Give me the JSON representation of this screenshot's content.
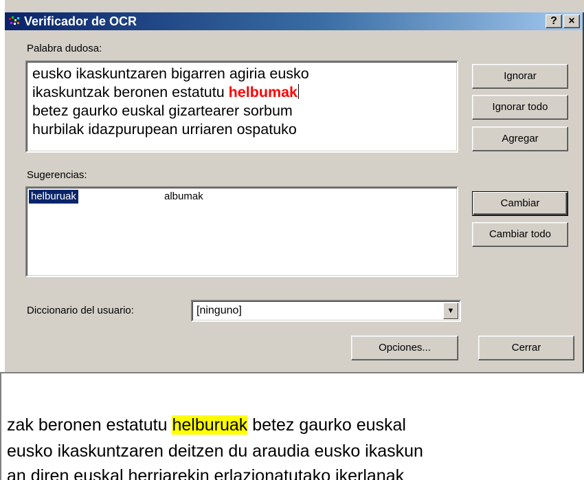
{
  "window": {
    "title": "Verificador de OCR",
    "help_button": "?",
    "close_button": "×"
  },
  "doubtful_word": {
    "label": "Palabra dudosa:",
    "text_before": "eusko ikaskuntzaren bigarren agiria eusko ikaskuntzak beronen estatutu ",
    "highlighted_word": "helbumak",
    "text_after": " betez gaurko euskal gizartearer sorbum hurbilak idazpurupean urriaren ospatuko",
    "highlight_color": "#ff0000"
  },
  "buttons": {
    "ignore": "Ignorar",
    "ignore_all": "Ignorar todo",
    "add": "Agregar",
    "change": "Cambiar",
    "change_all": "Cambiar todo",
    "options": "Opciones...",
    "close": "Cerrar"
  },
  "suggestions": {
    "label": "Sugerencias:",
    "items": [
      "helburuak",
      "albumak"
    ],
    "selected_index": 0
  },
  "user_dictionary": {
    "label": "Diccionario del usuario:",
    "selected": "[ninguno]"
  },
  "preview": {
    "lines": [
      {
        "before": "zak beronen estatutu ",
        "highlight": "helburuak",
        "after": " betez gaurko euskal"
      },
      {
        "before": " eusko ikaskuntzaren deitzen du araudia eusko ikaskun",
        "highlight": "",
        "after": ""
      },
      {
        "before": "an diren euskal herriarekin erlazionatutako ikerlanak",
        "highlight": "",
        "after": ""
      }
    ],
    "highlight_color": "#ffff00"
  }
}
